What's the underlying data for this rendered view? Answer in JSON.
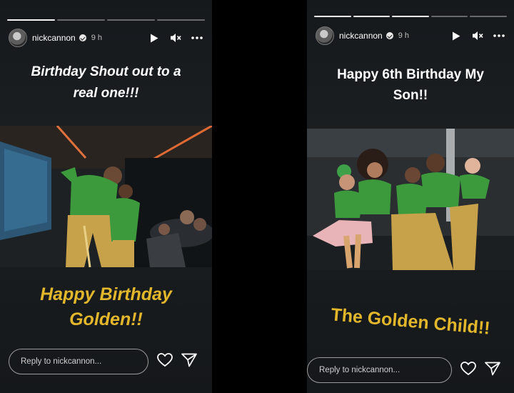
{
  "stories": [
    {
      "username": "nickcannon",
      "time": "9 h",
      "caption_top": "Birthday Shout out to a real one!!!",
      "caption_bottom_line1": "Happy Birthday",
      "caption_bottom_line2": "Golden!!",
      "reply_placeholder": "Reply to nickcannon..."
    },
    {
      "username": "nickcannon",
      "time": "9 h",
      "caption_top_line1": "Happy 6th Birthday My",
      "caption_top_line2": "Son!!",
      "caption_bottom": "The Golden Child!!",
      "reply_placeholder": "Reply to nickcannon..."
    }
  ],
  "icons": [
    "play-icon",
    "mute-icon",
    "more-icon",
    "heart-icon",
    "send-icon",
    "verified-icon"
  ],
  "colors": {
    "caption_gold": "#e3b72c",
    "shirt_green": "#3c9a3c",
    "pants_gold": "#c8a24a"
  }
}
